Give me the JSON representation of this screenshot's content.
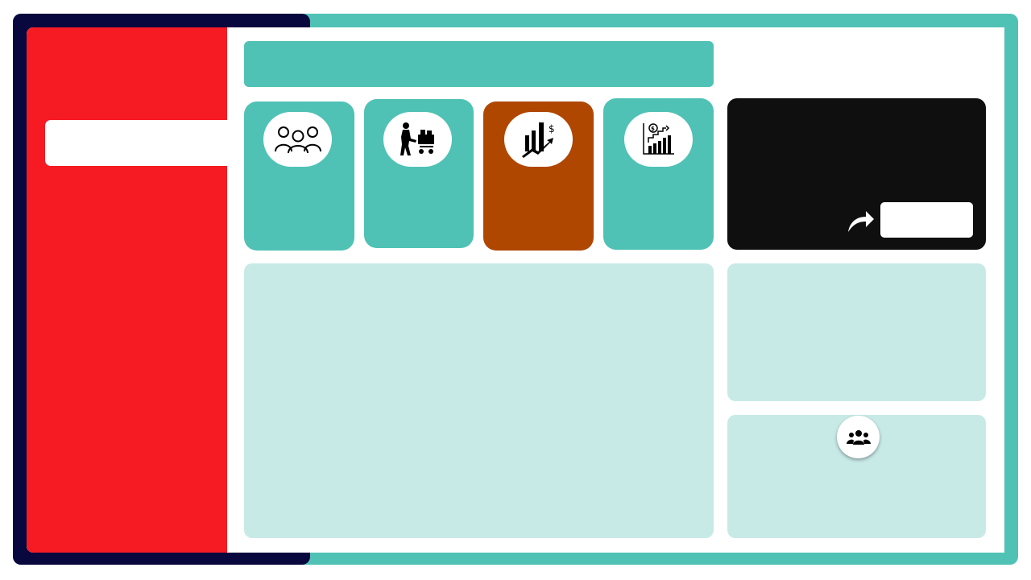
{
  "sidebar": {
    "nav_item_label": ""
  },
  "header": {
    "title": ""
  },
  "kpis": [
    {
      "icon": "people-group-icon",
      "label": "",
      "value": ""
    },
    {
      "icon": "shopping-cart-person-icon",
      "label": "",
      "value": ""
    },
    {
      "icon": "sales-growth-chart-icon",
      "label": "",
      "value": ""
    },
    {
      "icon": "revenue-growth-chart-icon",
      "label": "",
      "value": ""
    }
  ],
  "share": {
    "icon": "share-arrow-icon",
    "button_label": ""
  },
  "panels": {
    "main_title": "",
    "side_top_title": "",
    "side_bottom_title": "",
    "side_bottom_icon": "users-icon"
  },
  "colors": {
    "teal": "#4FC2B5",
    "navy": "#08073E",
    "red": "#F61A23",
    "rust": "#B04700",
    "black": "#0F0F0F",
    "light_teal": "#C8EAE7",
    "white": "#FFFFFF"
  }
}
